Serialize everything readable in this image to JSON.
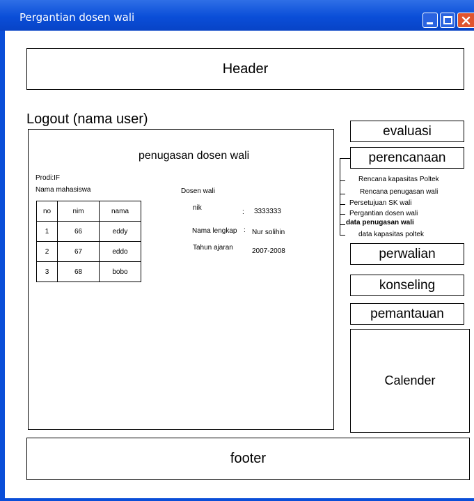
{
  "window": {
    "title": "Pergantian dosen wali"
  },
  "header": {
    "label": "Header"
  },
  "footer": {
    "label": "footer"
  },
  "logout": {
    "label": "Logout (nama user)"
  },
  "panel": {
    "title": "penugasan dosen wali",
    "prodi_label": "Prodi",
    "prodi_sep": ":",
    "prodi_value": "IF",
    "nama_mahasiswa_label": "Nama mahasiswa",
    "dosen_wali_label": "Dosen wali",
    "nik_label": "nik",
    "nik_sep": ":",
    "nik_value": "3333333",
    "nama_lengkap_label": "Nama lengkap",
    "nama_lengkap_sep": ":",
    "nama_lengkap_value": "Nur solihin",
    "tahun_ajaran_label": "Tahun ajaran",
    "tahun_ajaran_value": "2007-2008"
  },
  "table": {
    "headers": [
      "no",
      "nim",
      "nama"
    ],
    "rows": [
      [
        "1",
        "66",
        "eddy"
      ],
      [
        "2",
        "67",
        "eddo"
      ],
      [
        "3",
        "68",
        "bobo"
      ]
    ]
  },
  "menu": {
    "evaluasi": "evaluasi",
    "perencanaan": "perencanaan",
    "submenu": [
      "Rencana kapasitas Poltek",
      "Rencana penugasan wali",
      "Persetujuan SK wali",
      "Pergantian dosen wali",
      "data penugasan wali",
      "data kapasitas poltek"
    ],
    "perwalian": "perwalian",
    "konseling": "konseling",
    "pemantauan": "pemantauan"
  },
  "calendar": {
    "label": "Calender"
  }
}
